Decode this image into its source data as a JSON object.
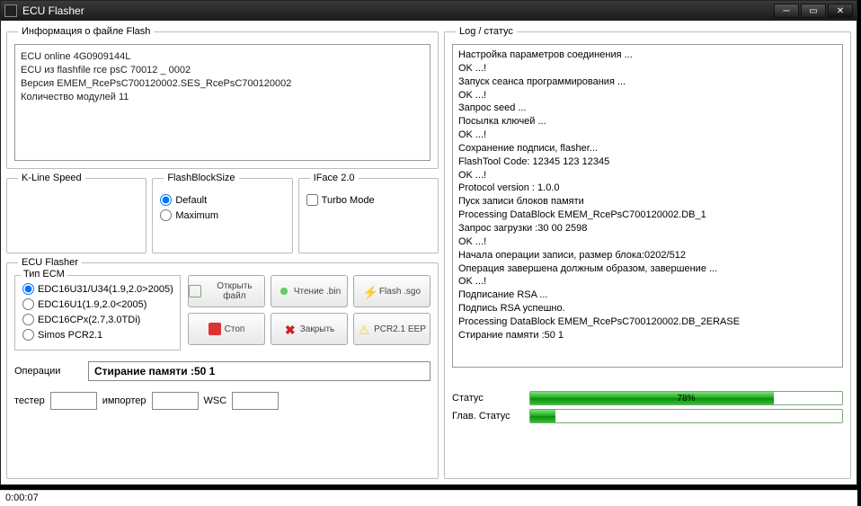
{
  "window": {
    "title": "ECU Flasher"
  },
  "flashinfo": {
    "legend": "Информация  о файле Flash",
    "lines": [
      "ECU online 4G0909144L",
      "ECU из flashfile rce psC 70012 _ 0002",
      "Версия EMEM_RcePsC700120002.SES_RcePsC700120002",
      "Количество модулей 11"
    ]
  },
  "kline": {
    "legend": "K-Line Speed"
  },
  "fbs": {
    "legend": "FlashBlockSize",
    "opt_default": "Default",
    "opt_max": "Maximum"
  },
  "iface": {
    "legend": "IFace 2.0",
    "turbo": "Turbo Mode"
  },
  "ecuflasher": {
    "legend": "ECU Flasher",
    "ecm_legend": "Тип ECM",
    "ecm_options": [
      "EDC16U31/U34(1.9,2.0>2005)",
      "EDC16U1(1.9,2.0<2005)",
      "EDC16CPx(2.7,3.0TDi)",
      "Simos PCR2.1"
    ],
    "btn_open": "Открыть файл",
    "btn_read": "Чтение .bin",
    "btn_flash": "Flash .sgo",
    "btn_stop": "Стоп",
    "btn_close": "Закрыть",
    "btn_pcr": "PCR2.1 EEP",
    "op_label": "Операции",
    "op_value": "Стирание памяти :50 1",
    "tester": "тестер",
    "importer": "импортер",
    "wsc": "WSC"
  },
  "log": {
    "legend": "Log / статус",
    "lines": [
      "Настройка параметров соединения ...",
      "OK ...!",
      "Запуск сеанса программирования ...",
      "OK ...!",
      "Запрос seed ...",
      "Посылка ключей ...",
      "OK ...!",
      "Сохранение подписи, flasher...",
      "FlashTool Code: 12345 123 12345",
      "OK ...!",
      "Protocol version : 1.0.0",
      "Пуск записи блоков памяти",
      "Processing DataBlock EMEM_RcePsC700120002.DB_1",
      "Запрос загрузки :30 00 2598",
      "OK ...!",
      "Начала операции записи, размер блока:0202/512",
      "Операция завершена должным образом, завершение ...",
      "OK ...!",
      "Подписание RSA ...",
      "Подпись RSA успешно.",
      "Processing DataBlock EMEM_RcePsC700120002.DB_2ERASE",
      "Стирание памяти :50 1"
    ],
    "status_label": "Статус",
    "status_pct": "78%",
    "status_fill": 78,
    "main_label": "Глав. Статус",
    "main_fill": 8
  },
  "statusbar": {
    "time": "0:00:07"
  }
}
